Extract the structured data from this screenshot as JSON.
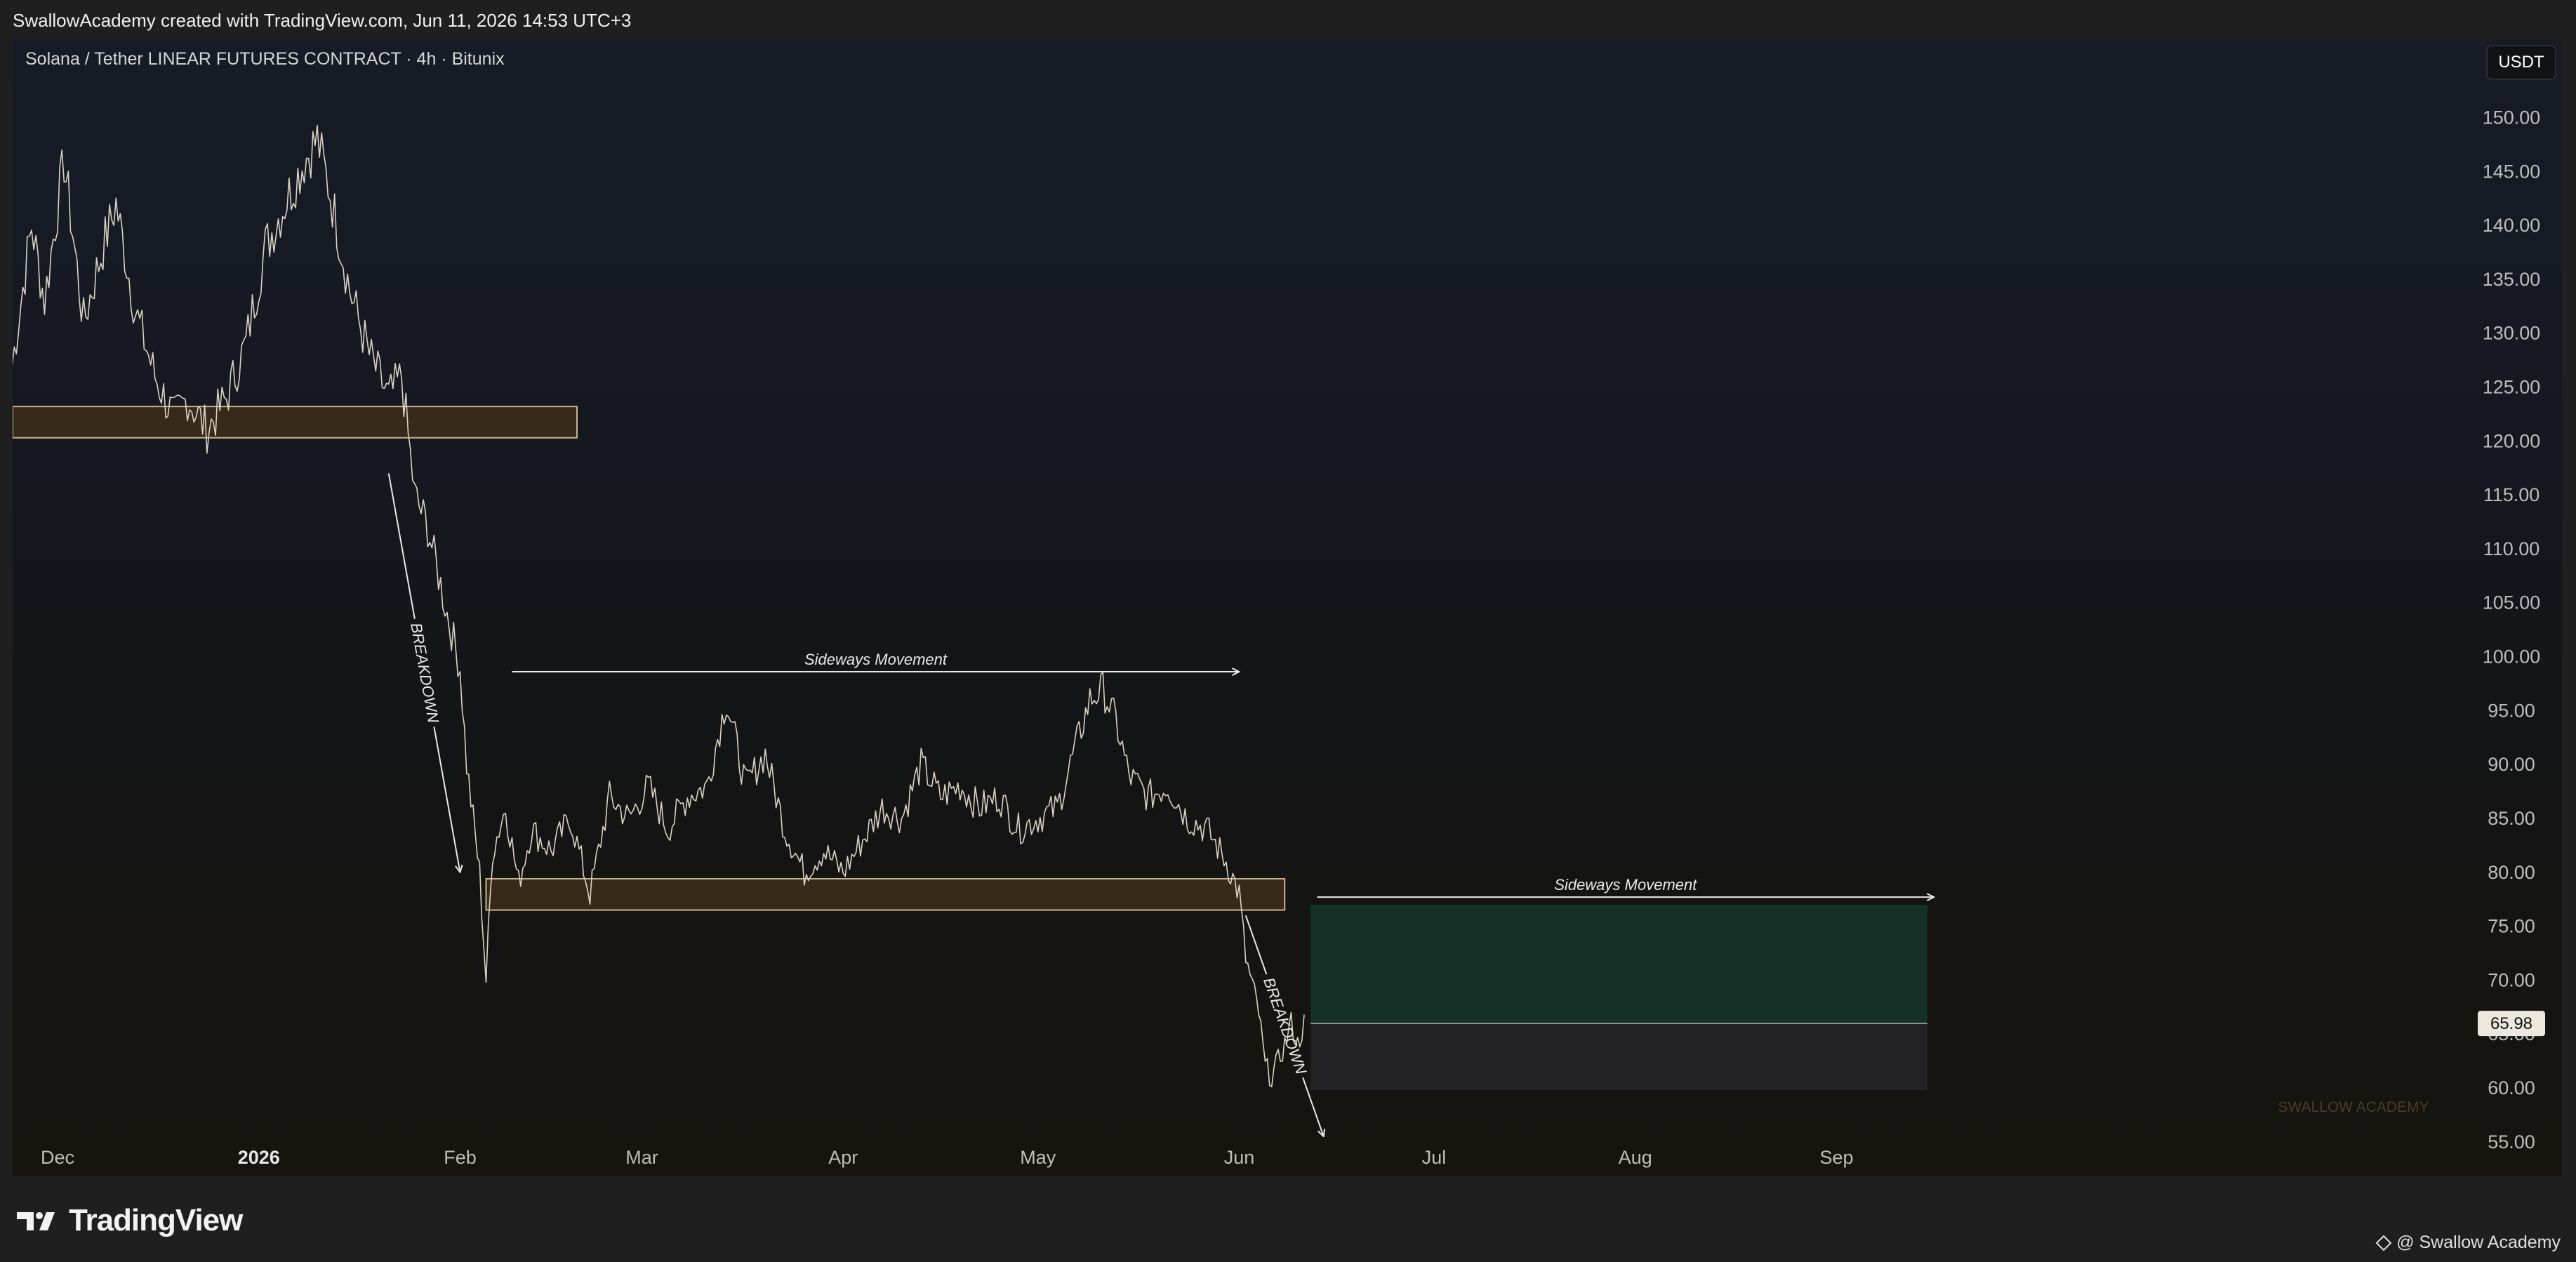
{
  "header": {
    "credit": "SwallowAcademy created with TradingView.com, Jun 11, 2026 14:53 UTC+3"
  },
  "chart": {
    "symbol_line": "Solana / Tether LINEAR FUTURES CONTRACT · 4h · Bitunix",
    "currency_button": "USDT",
    "watermark": "SWALLOW ACADEMY",
    "last_price_label": "65.98"
  },
  "footer": {
    "brand": "TradingView",
    "author": "@ Swallow Academy"
  },
  "colors": {
    "accent_candle": "#d9d2c3",
    "zone_fill": "#3b2c1a",
    "zone_border": "#c9b48a",
    "target_zone": "#16392e",
    "lower_zone": "#26262b",
    "price_label_bg": "#ece7df"
  },
  "chart_data": {
    "type": "line",
    "title": "Solana / Tether LINEAR FUTURES CONTRACT · 4h · Bitunix",
    "ylabel": "USDT",
    "ylim": [
      51.8,
      154
    ],
    "y_ticks": [
      55,
      60,
      65,
      70,
      75,
      80,
      85,
      90,
      95,
      100,
      105,
      110,
      115,
      120,
      125,
      130,
      135,
      140,
      145,
      150
    ],
    "x_ticks": [
      {
        "label": "Dec",
        "date": "2025-12-01",
        "bold": false
      },
      {
        "label": "2026",
        "date": "2026-01-01",
        "bold": true
      },
      {
        "label": "Feb",
        "date": "2026-02-01",
        "bold": false
      },
      {
        "label": "Mar",
        "date": "2026-03-01",
        "bold": false
      },
      {
        "label": "Apr",
        "date": "2026-04-01",
        "bold": false
      },
      {
        "label": "May",
        "date": "2026-05-01",
        "bold": false
      },
      {
        "label": "Jun",
        "date": "2026-06-01",
        "bold": false
      },
      {
        "label": "Jul",
        "date": "2026-07-01",
        "bold": false
      },
      {
        "label": "Aug",
        "date": "2026-08-01",
        "bold": false
      },
      {
        "label": "Sep",
        "date": "2026-09-01",
        "bold": false
      }
    ],
    "last_price": 65.98,
    "series": [
      {
        "color": "#d9d2c3",
        "points": [
          [
            "2025-11-24",
            127
          ],
          [
            "2025-11-27",
            140
          ],
          [
            "2025-11-29",
            133
          ],
          [
            "2025-12-02",
            146
          ],
          [
            "2025-12-05",
            131
          ],
          [
            "2025-12-08",
            138
          ],
          [
            "2025-12-10",
            142
          ],
          [
            "2025-12-13",
            132
          ],
          [
            "2025-12-16",
            126
          ],
          [
            "2025-12-19",
            122
          ],
          [
            "2025-12-21",
            124
          ],
          [
            "2025-12-24",
            121
          ],
          [
            "2025-12-27",
            124
          ],
          [
            "2025-12-30",
            129
          ],
          [
            "2026-01-02",
            138
          ],
          [
            "2026-01-05",
            142
          ],
          [
            "2026-01-08",
            146
          ],
          [
            "2026-01-10",
            148
          ],
          [
            "2026-01-12",
            143
          ],
          [
            "2026-01-15",
            134
          ],
          [
            "2026-01-18",
            128
          ],
          [
            "2026-01-21",
            124
          ],
          [
            "2026-01-23",
            126
          ],
          [
            "2026-01-25",
            115
          ],
          [
            "2026-01-27",
            112
          ],
          [
            "2026-01-30",
            104
          ],
          [
            "2026-02-01",
            99
          ],
          [
            "2026-02-02",
            90
          ],
          [
            "2026-02-03",
            85
          ],
          [
            "2026-02-04",
            80
          ],
          [
            "2026-02-05",
            70
          ],
          [
            "2026-02-06",
            82
          ],
          [
            "2026-02-08",
            86
          ],
          [
            "2026-02-10",
            79
          ],
          [
            "2026-02-12",
            84
          ],
          [
            "2026-02-15",
            82
          ],
          [
            "2026-02-18",
            85
          ],
          [
            "2026-02-21",
            78
          ],
          [
            "2026-02-24",
            87
          ],
          [
            "2026-02-27",
            85
          ],
          [
            "2026-03-02",
            88
          ],
          [
            "2026-03-05",
            84
          ],
          [
            "2026-03-08",
            87
          ],
          [
            "2026-03-11",
            88
          ],
          [
            "2026-03-14",
            96
          ],
          [
            "2026-03-17",
            88
          ],
          [
            "2026-03-20",
            91
          ],
          [
            "2026-03-23",
            84
          ],
          [
            "2026-03-26",
            80
          ],
          [
            "2026-03-29",
            82
          ],
          [
            "2026-04-01",
            80
          ],
          [
            "2026-04-04",
            83
          ],
          [
            "2026-04-07",
            86
          ],
          [
            "2026-04-10",
            85
          ],
          [
            "2026-04-13",
            90
          ],
          [
            "2026-04-16",
            87
          ],
          [
            "2026-04-19",
            88
          ],
          [
            "2026-04-22",
            86
          ],
          [
            "2026-04-25",
            87
          ],
          [
            "2026-04-28",
            84
          ],
          [
            "2026-05-01",
            85
          ],
          [
            "2026-05-04",
            86
          ],
          [
            "2026-05-07",
            92
          ],
          [
            "2026-05-09",
            96
          ],
          [
            "2026-05-11",
            97
          ],
          [
            "2026-05-13",
            94
          ],
          [
            "2026-05-15",
            89
          ],
          [
            "2026-05-18",
            87
          ],
          [
            "2026-05-21",
            88
          ],
          [
            "2026-05-24",
            85
          ],
          [
            "2026-05-27",
            84
          ],
          [
            "2026-05-30",
            81
          ],
          [
            "2026-06-01",
            78
          ],
          [
            "2026-06-02",
            72
          ],
          [
            "2026-06-04",
            67
          ],
          [
            "2026-06-05",
            62
          ],
          [
            "2026-06-06",
            61
          ],
          [
            "2026-06-08",
            64
          ],
          [
            "2026-06-09",
            66
          ],
          [
            "2026-06-10",
            64
          ],
          [
            "2026-06-11",
            65.98
          ]
        ]
      }
    ],
    "zones": [
      {
        "from": "2025-11-24",
        "to": "2026-02-19",
        "low": 120.3,
        "high": 123.2
      },
      {
        "from": "2026-02-05",
        "to": "2026-06-08",
        "low": 76.5,
        "high": 79.4
      }
    ],
    "projection": {
      "from": "2026-06-12",
      "to": "2026-09-15",
      "target_high": 77.0,
      "mid": 65.98,
      "low": 59.8
    },
    "annotations": [
      {
        "text": "BREAKDOWN",
        "from": [
          "2026-01-21",
          117
        ],
        "to": [
          "2026-02-01",
          80
        ]
      },
      {
        "text": "Sideways Movement",
        "from": [
          "2026-02-09",
          98.6
        ],
        "to": [
          "2026-06-01",
          98.6
        ]
      },
      {
        "text": "BREAKDOWN",
        "from": [
          "2026-06-02",
          76
        ],
        "to": [
          "2026-06-14",
          55.5
        ]
      },
      {
        "text": "Sideways Movement",
        "from": [
          "2026-06-13",
          77.7
        ],
        "to": [
          "2026-09-16",
          77.7
        ]
      }
    ]
  }
}
